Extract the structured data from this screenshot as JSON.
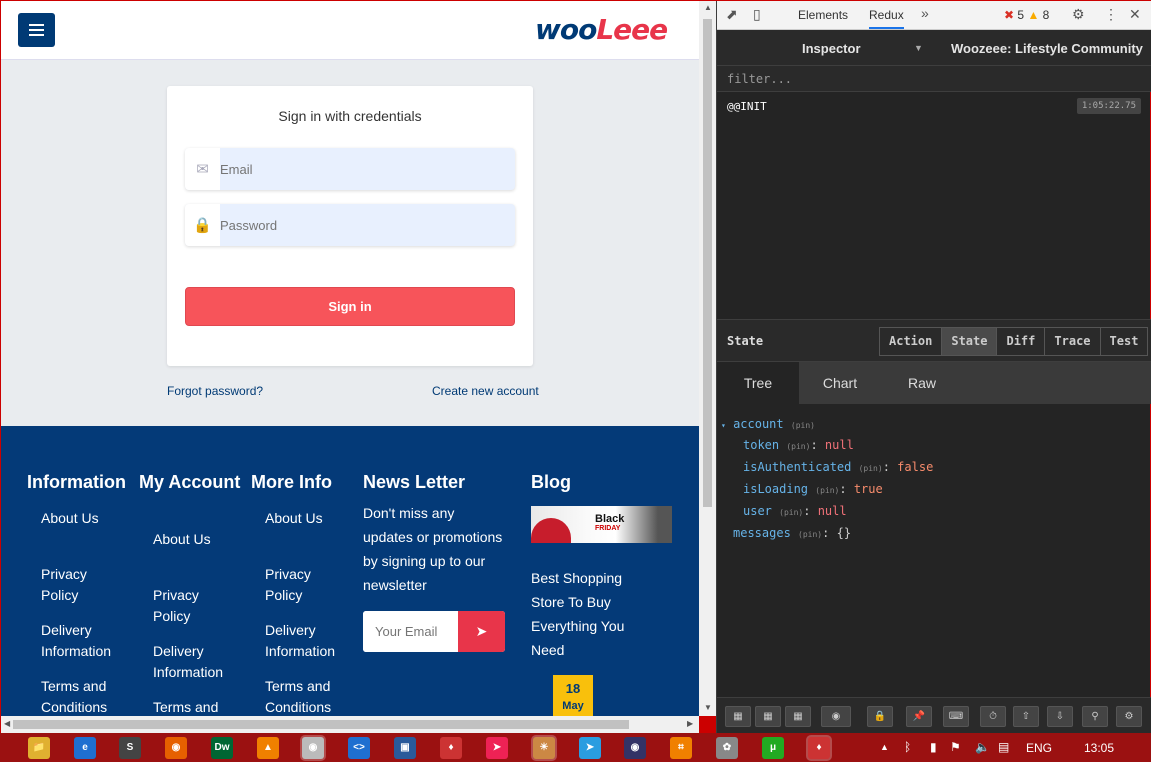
{
  "site": {
    "logo_part1": "woo",
    "logo_part2": "Leee",
    "login": {
      "title": "Sign in with credentials",
      "email_placeholder": "Email",
      "password_placeholder": "Password",
      "signin_label": "Sign in",
      "forgot_label": "Forgot password?",
      "create_label": "Create new account"
    },
    "footer": {
      "col1": {
        "heading": "Information",
        "links": [
          "About Us",
          "Privacy Policy",
          "Delivery Information",
          "Terms and Conditions"
        ]
      },
      "col2": {
        "heading": "My Account",
        "links": [
          "About Us",
          "Privacy Policy",
          "Delivery Information",
          "Terms and"
        ]
      },
      "col3": {
        "heading": "More Info",
        "links": [
          "About Us",
          "Privacy Policy",
          "Delivery Information",
          "Terms and Conditions"
        ]
      },
      "newsletter": {
        "heading": "News Letter",
        "text": "Don't miss any updates or promotions by signing up to our newsletter",
        "placeholder": "Your Email"
      },
      "blog": {
        "heading": "Blog",
        "image_line1": "Black",
        "image_line2": "FRIDAY",
        "post_title": "Best Shopping Store To Buy Everything You Need",
        "day": "18",
        "month": "May"
      }
    }
  },
  "devtools": {
    "tabs": [
      "Elements",
      "Redux"
    ],
    "active_tab": "Redux",
    "errors": "5",
    "warnings": "8",
    "inspector_label": "Inspector",
    "instance": "Woozeee: Lifestyle Community",
    "filter_placeholder": "filter...",
    "action": {
      "name": "@@INIT",
      "time": "1:05:22.75"
    },
    "state_label": "State",
    "mode_tabs": [
      "Action",
      "State",
      "Diff",
      "Trace",
      "Test"
    ],
    "active_mode": "State",
    "view_tabs": [
      "Tree",
      "Chart",
      "Raw"
    ],
    "active_view": "Tree",
    "tree": {
      "account_key": "account",
      "pin": "(pin)",
      "token_key": "token",
      "token_val": "null",
      "auth_key": "isAuthenticated",
      "auth_val": "false",
      "loading_key": "isLoading",
      "loading_val": "true",
      "user_key": "user",
      "user_val": "null",
      "messages_key": "messages",
      "messages_val": "{}"
    }
  },
  "taskbar": {
    "language": "ENG",
    "time": "13:05"
  },
  "colors": {
    "brand_blue": "#003a75",
    "brand_red": "#e8354a",
    "signin_red": "#f7545a",
    "footer_bg": "#043a78",
    "taskbar_bg": "#9b1111"
  }
}
